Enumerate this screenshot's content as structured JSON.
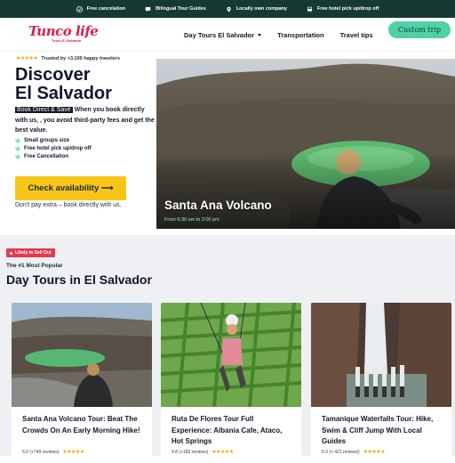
{
  "topbar": {
    "items": [
      {
        "label": "Free cancelation",
        "icon": "check-circle-icon"
      },
      {
        "label": "Bilingual Tour Guides",
        "icon": "chat-icon"
      },
      {
        "label": "Locally own company",
        "icon": "location-pin-icon"
      },
      {
        "label": "Free hotel pick up/drop off",
        "icon": "bus-icon"
      }
    ]
  },
  "nav": {
    "logo_text": "Tunco life",
    "logo_sub": "Tours El Salvador",
    "links": [
      "Day Tours El Salvador",
      "Transportation",
      "Travel tips"
    ],
    "cta": "Custom trip"
  },
  "hero": {
    "stars": "★★★★★",
    "trusted": "Trusted by +3,100 happy travelers",
    "title_line1": "Discover",
    "title_line2": "El Salvador",
    "highlight": "Book Direct & Save",
    "copy": " When you book directly with us, , you avoid third-party fees and get the best value.",
    "features": [
      "Small groups size",
      "Free hotel pick up/drop off",
      "Free Cancellation"
    ],
    "button": "Check availability ⟶",
    "note": "Don't pay extra – book directly with us.",
    "image_caption": "Santa Ana Volcano",
    "image_time": "From 6:30 am to 2:00 pm"
  },
  "tours": {
    "badge": "Likely to Sell Out",
    "eyebrow": "The #1 Most Popular",
    "title": "Day Tours in El Salvador",
    "cards": [
      {
        "title": "Santa Ana Volcano Tour: Beat The Crowds On An Early Morning Hike!",
        "rating": "5.0 (+749 reviews)",
        "stars": "★★★★★"
      },
      {
        "title": "Ruta De Flores Tour Full Experience: Albania Cafe, Ataco, Hot Springs",
        "rating": "4.8 (+182 reviews)",
        "stars": "★★★★★"
      },
      {
        "title": "Tamanique Waterfalls Tour: Hike, Swim & Cliff Jump With Local Guides",
        "rating": "5.0 (+ 421 reviews)",
        "stars": "★★★★★"
      }
    ]
  },
  "colors": {
    "topbar": "#153a34",
    "brand": "#d81f4a",
    "accent_green": "#4fd1a5",
    "cta_yellow": "#f5c518",
    "badge_red": "#e23a4e",
    "star": "#f59e0b"
  }
}
